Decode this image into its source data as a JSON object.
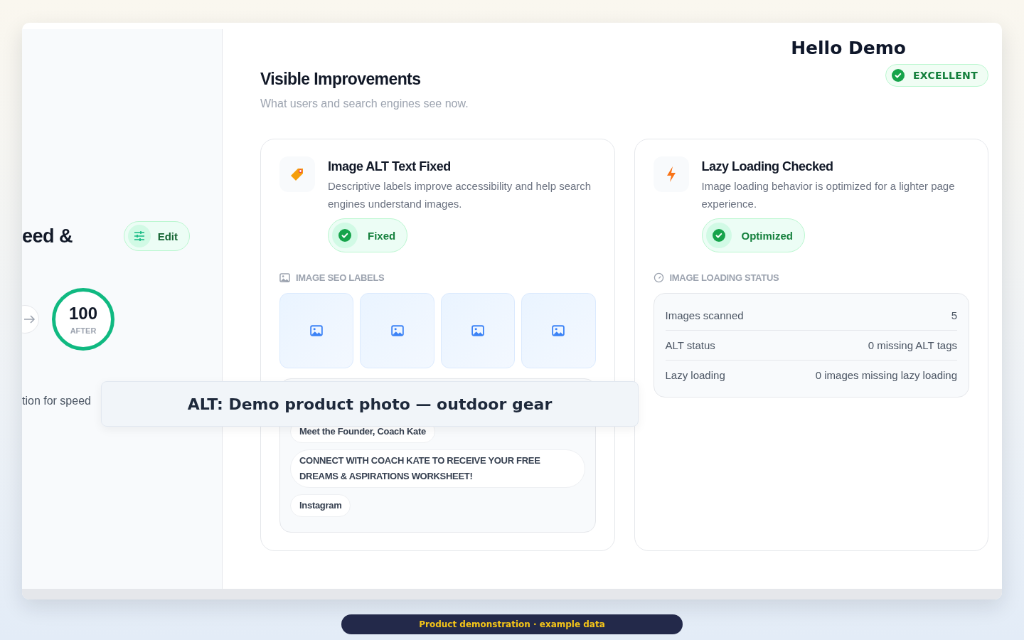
{
  "sidebar": {
    "heading": "eed &",
    "edit_button": "Edit",
    "score": "100",
    "score_label": "AFTER",
    "caption": "tion for speed"
  },
  "header": {
    "title": "Visible Improvements",
    "subtitle": "What users and search engines see now.",
    "greeting": "Hello Demo",
    "badge": "EXCELLENT"
  },
  "cards": [
    {
      "kind": "alt",
      "title": "Image ALT Text Fixed",
      "description": "Descriptive labels improve accessibility and help search engines understand images.",
      "status": "Fixed",
      "section_label": "IMAGE SEO LABELS",
      "image_tiles": [
        {
          "kind": "placeholder"
        },
        {
          "kind": "placeholder"
        },
        {
          "kind": "placeholder"
        },
        {
          "kind": "placeholder"
        }
      ],
      "labels": [
        "Meet the Founder, Coach Kate",
        "CONNECT WITH COACH KATE TO RECEIVE YOUR FREE DREAMS & ASPIRATIONS WORKSHEET!",
        "Instagram"
      ]
    },
    {
      "kind": "lazy",
      "title": "Lazy Loading Checked",
      "description": "Image loading behavior is optimized for a lighter page experience.",
      "status": "Optimized",
      "section_label": "IMAGE LOADING STATUS",
      "stats": [
        {
          "label": "Images scanned",
          "value": "5"
        },
        {
          "label": "ALT status",
          "value": "0 missing ALT tags"
        },
        {
          "label": "Lazy loading",
          "value": "0 images missing lazy loading"
        }
      ]
    }
  ],
  "tooltip": "ALT: Demo product photo — outdoor gear",
  "banner": "Product demonstration · example data"
}
